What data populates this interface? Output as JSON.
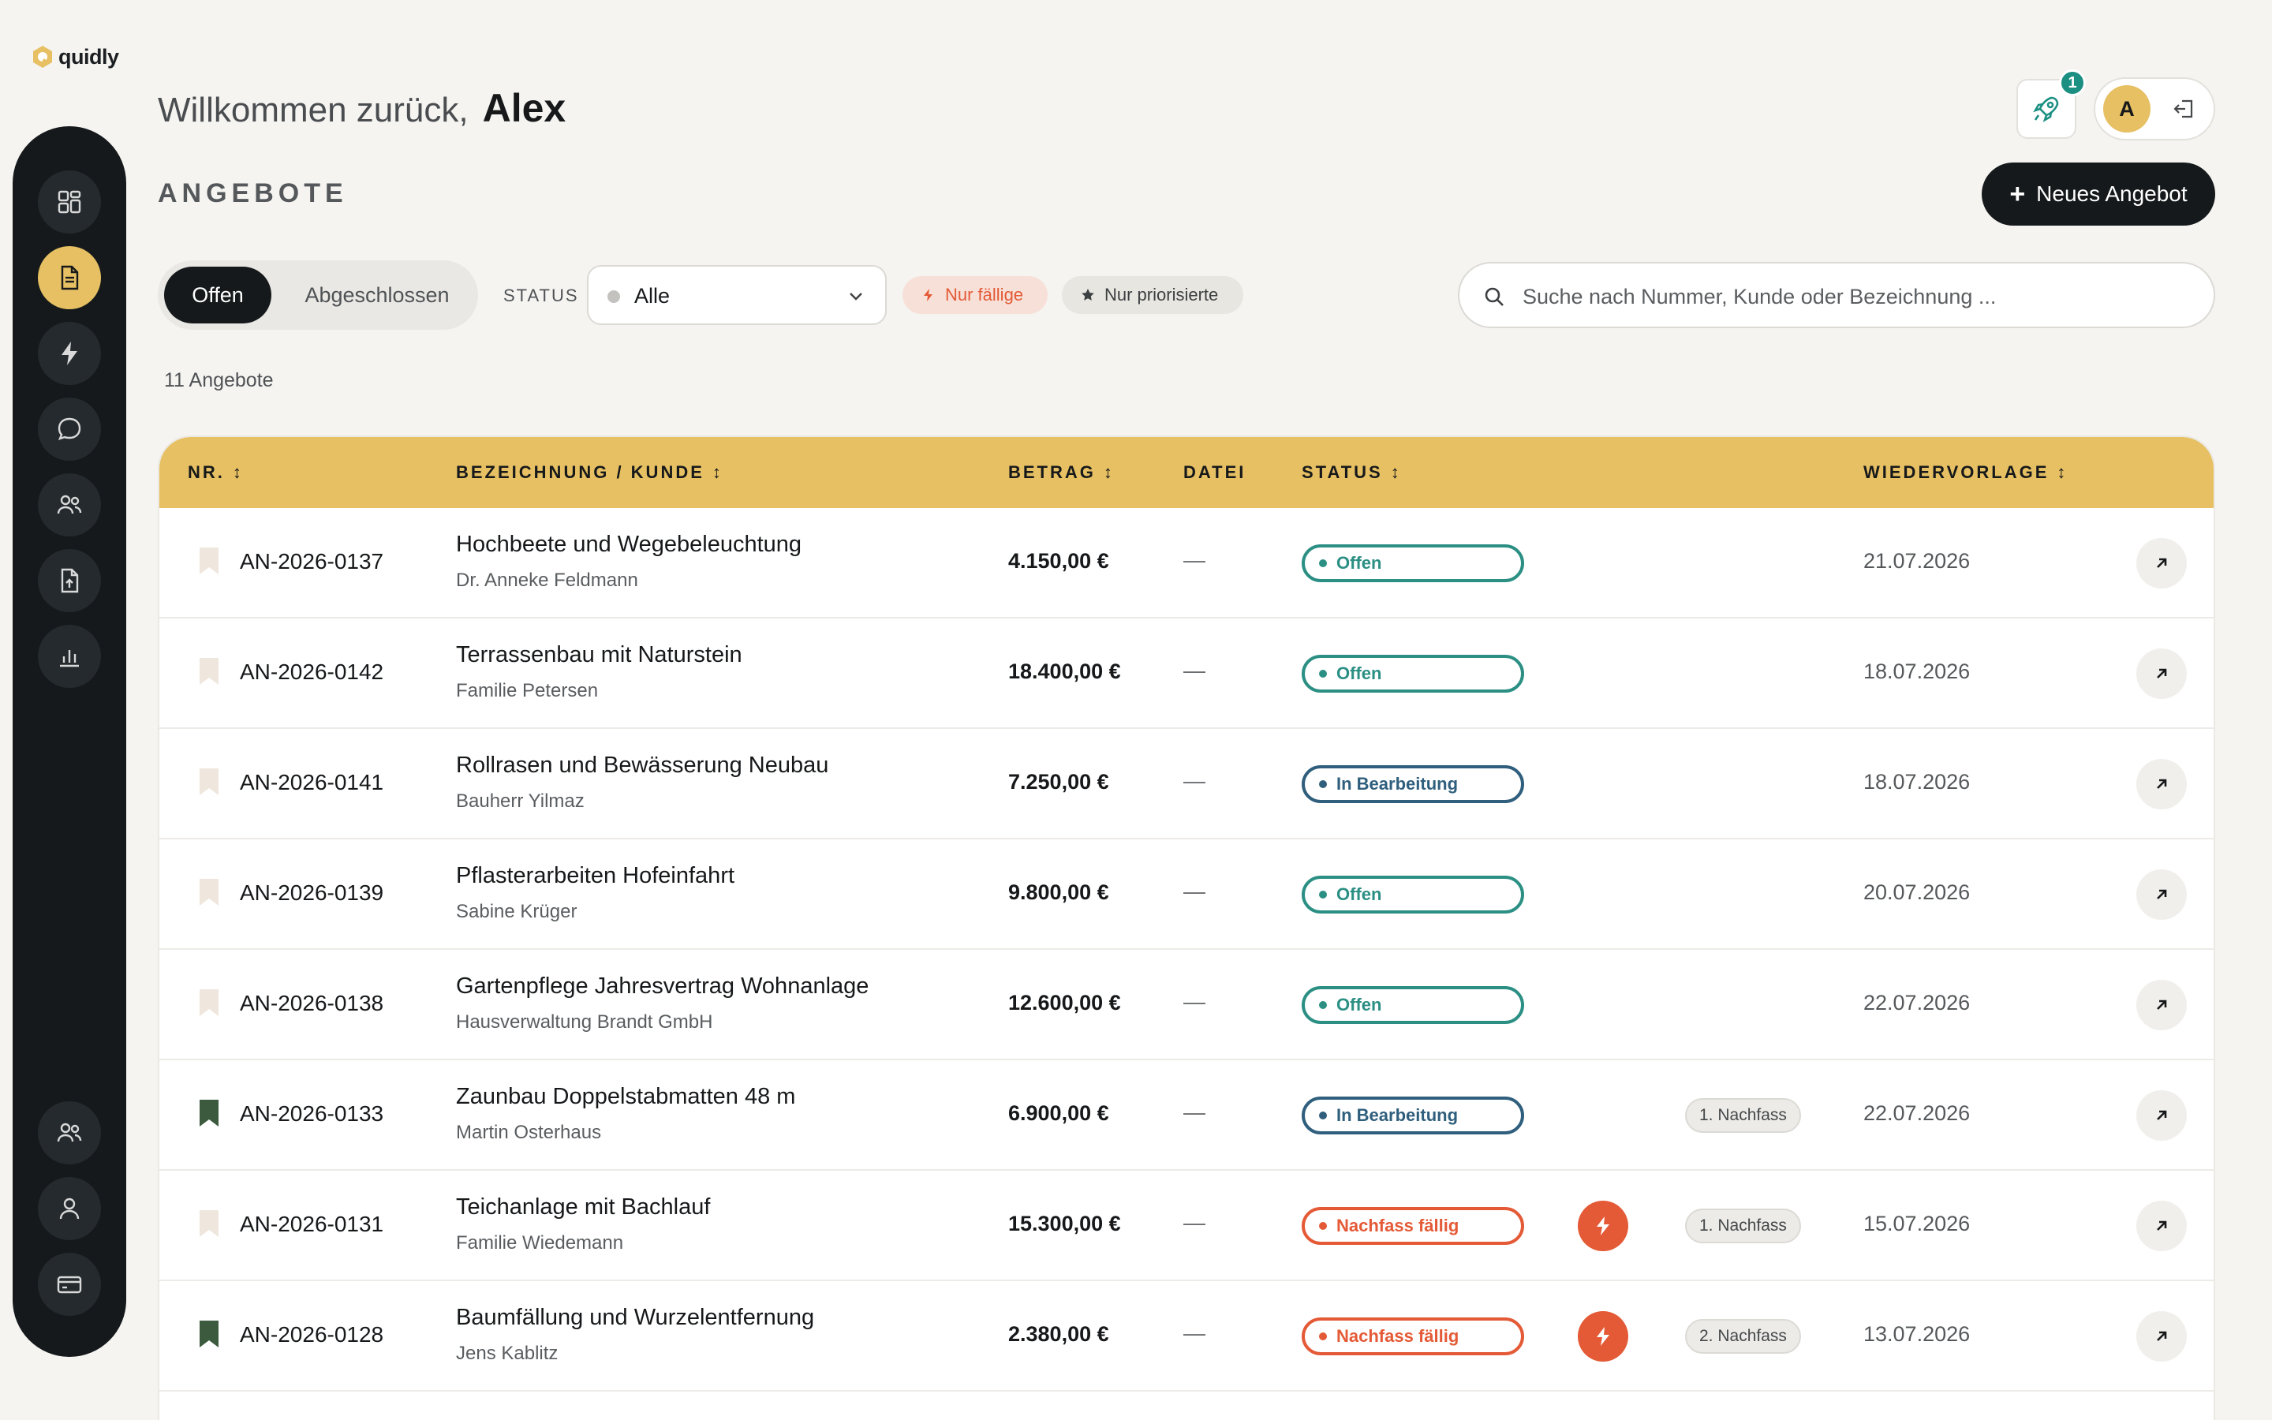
{
  "app": {
    "logo_text": "quidly"
  },
  "header": {
    "welcome_text": "Willkommen zurück,",
    "user_name": "Alex",
    "section_title": "ANGEBOTE",
    "notification_count": "1",
    "avatar_initial": "A",
    "new_button_label": "Neues Angebot"
  },
  "filters": {
    "tab_open": "Offen",
    "tab_closed": "Abgeschlossen",
    "status_label": "STATUS",
    "status_value": "Alle",
    "chip_due": "Nur fällige",
    "chip_priority": "Nur priorisierte",
    "search_placeholder": "Suche nach Nummer, Kunde oder Bezeichnung ..."
  },
  "count_text": "11 Angebote",
  "table": {
    "columns": {
      "nr": "NR.",
      "title": "BEZEICHNUNG / KUNDE",
      "amount": "BETRAG",
      "file": "DATEI",
      "status": "STATUS",
      "followup": "WIEDERVORLAGE",
      "sort_glyph": "↕"
    },
    "rows": [
      {
        "nr": "AN-2026-0137",
        "title": "Hochbeete und Wegebeleuchtung",
        "customer": "Dr. Anneke Feldmann",
        "amount": "4.150,00 €",
        "file": "—",
        "status": "Offen",
        "status_type": "open",
        "prioritized": false,
        "due": false,
        "nachfass": "",
        "date": "21.07.2026"
      },
      {
        "nr": "AN-2026-0142",
        "title": "Terrassenbau mit Naturstein",
        "customer": "Familie Petersen",
        "amount": "18.400,00 €",
        "file": "—",
        "status": "Offen",
        "status_type": "open",
        "prioritized": false,
        "due": false,
        "nachfass": "",
        "date": "18.07.2026"
      },
      {
        "nr": "AN-2026-0141",
        "title": "Rollrasen und Bewässerung Neubau",
        "customer": "Bauherr Yilmaz",
        "amount": "7.250,00 €",
        "file": "—",
        "status": "In Bearbeitung",
        "status_type": "work",
        "prioritized": false,
        "due": false,
        "nachfass": "",
        "date": "18.07.2026"
      },
      {
        "nr": "AN-2026-0139",
        "title": "Pflasterarbeiten Hofeinfahrt",
        "customer": "Sabine Krüger",
        "amount": "9.800,00 €",
        "file": "—",
        "status": "Offen",
        "status_type": "open",
        "prioritized": false,
        "due": false,
        "nachfass": "",
        "date": "20.07.2026"
      },
      {
        "nr": "AN-2026-0138",
        "title": "Gartenpflege Jahresvertrag Wohnanlage",
        "customer": "Hausverwaltung Brandt GmbH",
        "amount": "12.600,00 €",
        "file": "—",
        "status": "Offen",
        "status_type": "open",
        "prioritized": false,
        "due": false,
        "nachfass": "",
        "date": "22.07.2026"
      },
      {
        "nr": "AN-2026-0133",
        "title": "Zaunbau Doppelstabmatten 48 m",
        "customer": "Martin Osterhaus",
        "amount": "6.900,00 €",
        "file": "—",
        "status": "In Bearbeitung",
        "status_type": "work",
        "prioritized": true,
        "due": false,
        "nachfass": "1. Nachfass",
        "date": "22.07.2026"
      },
      {
        "nr": "AN-2026-0131",
        "title": "Teichanlage mit Bachlauf",
        "customer": "Familie Wiedemann",
        "amount": "15.300,00 €",
        "file": "—",
        "status": "Nachfass fällig",
        "status_type": "due",
        "prioritized": false,
        "due": true,
        "nachfass": "1. Nachfass",
        "date": "15.07.2026"
      },
      {
        "nr": "AN-2026-0128",
        "title": "Baumfällung und Wurzelentfernung",
        "customer": "Jens Kablitz",
        "amount": "2.380,00 €",
        "file": "—",
        "status": "Nachfass fällig",
        "status_type": "due",
        "prioritized": true,
        "due": true,
        "nachfass": "2. Nachfass",
        "date": "13.07.2026"
      }
    ]
  },
  "colors": {
    "accent": "#e6c063",
    "sidebar": "#15191b",
    "open": "#2b8f84",
    "in_progress": "#2f5f7d",
    "due": "#e45a36",
    "bookmark_on": "#3c5a3e",
    "bookmark_off": "#efe7dd"
  }
}
